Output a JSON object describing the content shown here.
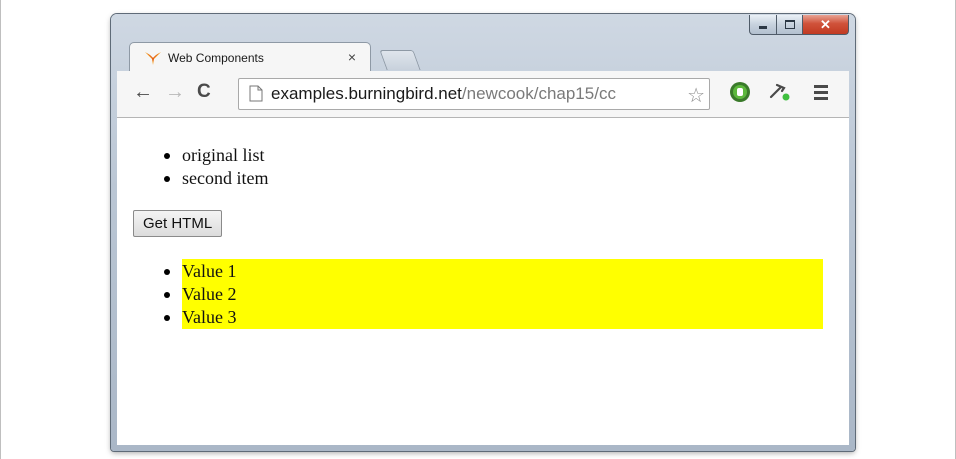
{
  "browser": {
    "tab_title": "Web Components",
    "tab_close": "×",
    "url_host": "examples.burningbird.net",
    "url_path": "/newcook/chap15/cc",
    "icons": {
      "back": "back-arrow-icon",
      "forward": "forward-arrow-icon",
      "reload": "reload-icon",
      "page": "page-icon",
      "star": "star-icon",
      "extension": "extension-icon",
      "tools": "tools-icon",
      "menu": "menu-icon"
    },
    "colors": {
      "close_button": "#c13a22",
      "highlight": "#ffff00"
    }
  },
  "page": {
    "original_list": [
      "original list",
      "second item"
    ],
    "button_label": "Get HTML",
    "generated_list": [
      "Value 1",
      "Value 2",
      "Value 3"
    ]
  }
}
